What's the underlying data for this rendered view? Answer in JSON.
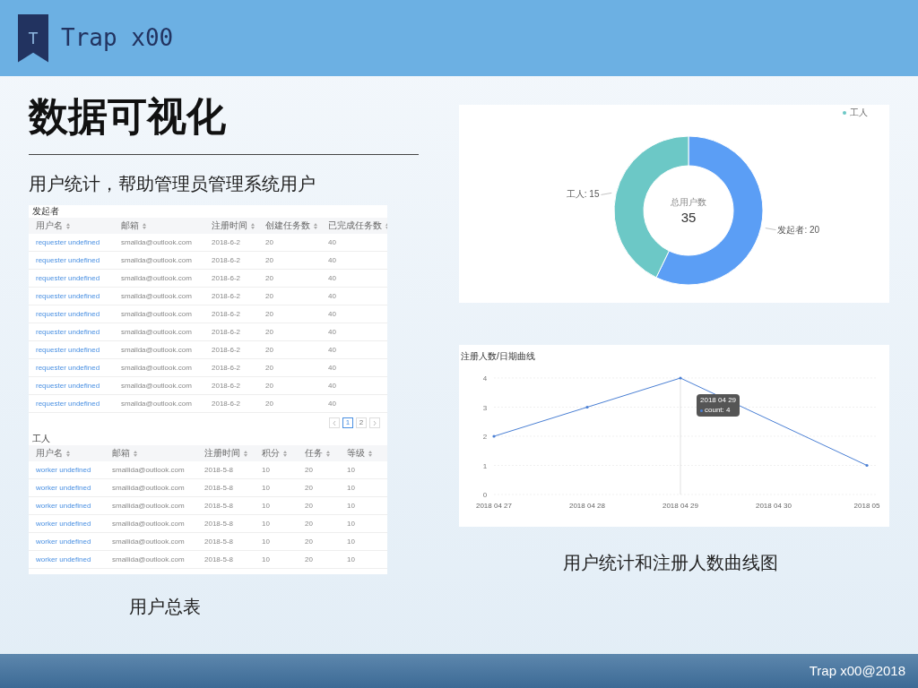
{
  "header": {
    "logo_letter": "T",
    "brand": "Trap x00"
  },
  "title": "数据可视化",
  "subtitle": "用户统计，帮助管理员管理系统用户",
  "tables": [
    {
      "title": "发起者",
      "columns": [
        "用户名",
        "邮箱",
        "注册时间",
        "创建任务数",
        "已完成任务数"
      ],
      "rows": [
        [
          "requester undefined",
          "smallda@outlook.com",
          "2018-6-2",
          "20",
          "40"
        ],
        [
          "requester undefined",
          "smallda@outlook.com",
          "2018-6-2",
          "20",
          "40"
        ],
        [
          "requester undefined",
          "smallda@outlook.com",
          "2018-6-2",
          "20",
          "40"
        ],
        [
          "requester undefined",
          "smallda@outlook.com",
          "2018-6-2",
          "20",
          "40"
        ],
        [
          "requester undefined",
          "smallda@outlook.com",
          "2018-6-2",
          "20",
          "40"
        ],
        [
          "requester undefined",
          "smallda@outlook.com",
          "2018-6-2",
          "20",
          "40"
        ],
        [
          "requester undefined",
          "smallda@outlook.com",
          "2018-6-2",
          "20",
          "40"
        ],
        [
          "requester undefined",
          "smallda@outlook.com",
          "2018-6-2",
          "20",
          "40"
        ],
        [
          "requester undefined",
          "smallda@outlook.com",
          "2018-6-2",
          "20",
          "40"
        ],
        [
          "requester undefined",
          "smallda@outlook.com",
          "2018-6-2",
          "20",
          "40"
        ]
      ],
      "pagination": [
        {
          "label": "1",
          "selected": true
        },
        {
          "label": "2",
          "selected": false
        }
      ]
    },
    {
      "title": "工人",
      "columns": [
        "用户名",
        "邮箱",
        "注册时间",
        "积分",
        "任务",
        "等级"
      ],
      "rows": [
        [
          "worker undefined",
          "smallida@outlook.com",
          "2018-5-8",
          "10",
          "20",
          "10"
        ],
        [
          "worker undefined",
          "smallida@outlook.com",
          "2018-5-8",
          "10",
          "20",
          "10"
        ],
        [
          "worker undefined",
          "smallida@outlook.com",
          "2018-5-8",
          "10",
          "20",
          "10"
        ],
        [
          "worker undefined",
          "smallida@outlook.com",
          "2018-5-8",
          "10",
          "20",
          "10"
        ],
        [
          "worker undefined",
          "smallida@outlook.com",
          "2018-5-8",
          "10",
          "20",
          "10"
        ],
        [
          "worker undefined",
          "smallida@outlook.com",
          "2018-5-8",
          "10",
          "20",
          "10"
        ]
      ]
    }
  ],
  "table_caption": "用户总表",
  "donut": {
    "legend": [
      {
        "label": "工人",
        "color": "#6cc8c6"
      }
    ],
    "center_label": "总用户数",
    "center_value": "35",
    "chart_data": {
      "type": "donut",
      "categories": [
        "发起者: 20",
        "工人: 15"
      ],
      "values": [
        20,
        15
      ]
    }
  },
  "line": {
    "title": "注册人数/日期曲线",
    "tooltip": {
      "date": "2018 04 29",
      "text": "count: 4"
    },
    "chart_data": {
      "type": "line",
      "categories": [
        "2018 04 27",
        "2018 04 28",
        "2018 04 29",
        "2018 04 30",
        "2018 05"
      ],
      "series": [
        {
          "color": "#4a7fd4",
          "values": [
            2,
            3,
            4,
            null,
            1
          ]
        }
      ],
      "grid": true,
      "ref_lines": [
        {
          "axis": "x",
          "value": "2018 04 29",
          "color": "#cccccc"
        }
      ],
      "yticks": [
        0,
        1,
        2,
        3,
        4
      ],
      "ylim": [
        0,
        4
      ]
    }
  },
  "charts_caption": "用户统计和注册人数曲线图",
  "footer": "Trap x00@2018"
}
